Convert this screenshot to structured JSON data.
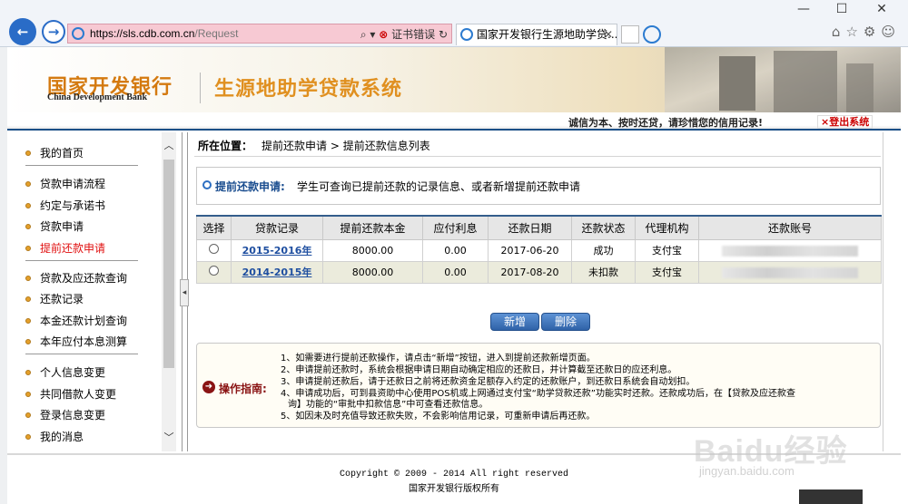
{
  "browser": {
    "url_host": "https://sls.cdb.com.cn",
    "url_path": "/Request",
    "cert_error": "证书错误",
    "tab_title": "国家开发银行生源地助学贷...",
    "window_controls": [
      "—",
      "☐",
      "✕"
    ]
  },
  "banner": {
    "logo_cn": "国家开发银行",
    "logo_en": "China Development Bank",
    "system_title": "生源地助学贷款系统",
    "slogan": "诚信为本、按时还贷，请珍惜您的信用记录!",
    "logout": "×登出系统"
  },
  "sidebar": {
    "items": [
      {
        "label": "我的首页"
      },
      {
        "label": "贷款申请流程"
      },
      {
        "label": "约定与承诺书"
      },
      {
        "label": "贷款申请"
      },
      {
        "label": "提前还款申请",
        "active": true
      },
      {
        "label": "贷款及应还款查询"
      },
      {
        "label": "还款记录"
      },
      {
        "label": "本金还款计划查询"
      },
      {
        "label": "本年应付本息测算"
      },
      {
        "label": "个人信息变更"
      },
      {
        "label": "共同借款人变更"
      },
      {
        "label": "登录信息变更"
      },
      {
        "label": "我的消息"
      }
    ]
  },
  "breadcrumb": {
    "label": "所在位置：",
    "path": "提前还款申请 > 提前还款信息列表"
  },
  "info": {
    "label": "提前还款申请:",
    "text": "学生可查询已提前还款的记录信息、或者新增提前还款申请"
  },
  "table": {
    "headers": [
      "选择",
      "贷款记录",
      "提前还款本金",
      "应付利息",
      "还款日期",
      "还款状态",
      "代理机构",
      "还款账号"
    ],
    "rows": [
      {
        "record": "2015-2016年",
        "principal": "8000.00",
        "interest": "0.00",
        "date": "2017-06-20",
        "status": "成功",
        "agent": "支付宝"
      },
      {
        "record": "2014-2015年",
        "principal": "8000.00",
        "interest": "0.00",
        "date": "2017-08-20",
        "status": "未扣款",
        "agent": "支付宝"
      }
    ]
  },
  "buttons": {
    "add": "新增",
    "delete": "删除"
  },
  "guide": {
    "label": "操作指南:",
    "lines": [
      "1、如需要进行提前还款操作，请点击“新增”按钮，进入到提前还款新增页面。",
      "2、申请提前还款时，系统会根据申请日期自动确定相应的还款日，并计算截至还款日的应还利息。",
      "3、申请提前还款后，请于还款日之前将还款资金足额存入约定的还款账户，到还款日系统会自动划扣。",
      "4、申请成功后，可到县资助中心使用POS机或上网通过支付宝“助学贷款还款”功能实时还款。还款成功后，在【贷款及应还款查",
      "询】功能的“审批中扣款信息”中可查看还款信息。",
      "5、如因未及时充值导致还款失败，不会影响信用记录，可重新申请后再还款。"
    ]
  },
  "footer": {
    "copyright": "Copyright © 2009 - 2014 All right reserved",
    "owner": "国家开发银行版权所有"
  },
  "watermark": {
    "brand": "Baidu经验",
    "url": "jingyan.baidu.com"
  },
  "colors": {
    "accent_blue": "#2f62a8",
    "active_menu": "#e01010",
    "logo_orange": "#d47a10"
  }
}
